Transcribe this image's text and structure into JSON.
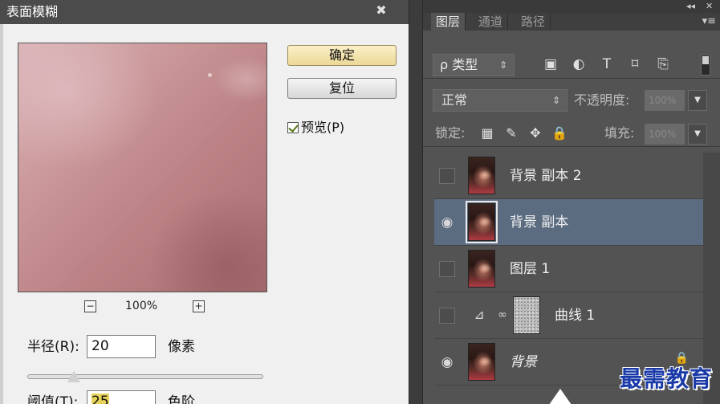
{
  "dialog": {
    "title": "表面模糊",
    "close_glyph": "✖",
    "zoom": {
      "out_glyph": "−",
      "level": "100%",
      "in_glyph": "+"
    },
    "buttons": {
      "ok": "确定",
      "reset": "复位"
    },
    "preview_checkbox": {
      "label": "预览(P)",
      "checked": true
    },
    "radius": {
      "label": "半径(R):",
      "value": "20",
      "unit": "像素",
      "slider_fraction": 0.18
    },
    "threshold": {
      "label": "阈值(T):",
      "value": "25",
      "unit": "色阶"
    }
  },
  "panel": {
    "top_controls": {
      "collapse": "◂◂",
      "close": "✕"
    },
    "tabs": [
      {
        "label": "图层",
        "active": true
      },
      {
        "label": "通道",
        "active": false
      },
      {
        "label": "路径",
        "active": false
      }
    ],
    "menu_glyph": "▾≡",
    "filter": {
      "kind_label": "ρ 类型",
      "kind_arrow": "⇕",
      "icons": [
        {
          "name": "pixel-filter-icon",
          "glyph": "▣"
        },
        {
          "name": "adjustment-filter-icon",
          "glyph": "◐"
        },
        {
          "name": "type-filter-icon",
          "glyph": "T"
        },
        {
          "name": "shape-filter-icon",
          "glyph": "⌑"
        },
        {
          "name": "smart-object-filter-icon",
          "glyph": "⎘"
        }
      ]
    },
    "blend": {
      "mode": "正常",
      "arrow": "⇕",
      "opacity_label": "不透明度:",
      "opacity_value": "100%"
    },
    "lock": {
      "label": "锁定:",
      "icons": [
        {
          "name": "lock-transparent-icon",
          "glyph": "▦"
        },
        {
          "name": "lock-paint-icon",
          "glyph": "✎"
        },
        {
          "name": "lock-position-icon",
          "glyph": "✥"
        },
        {
          "name": "lock-all-icon",
          "glyph": "🔒"
        }
      ],
      "fill_label": "填充:",
      "fill_value": "100%"
    },
    "layers": [
      {
        "name": "背景 副本 2",
        "visible": false,
        "selected": false,
        "type": "image"
      },
      {
        "name": "背景 副本",
        "visible": true,
        "selected": true,
        "type": "image"
      },
      {
        "name": "图层 1",
        "visible": false,
        "selected": false,
        "type": "image"
      },
      {
        "name": "曲线 1",
        "visible": false,
        "selected": false,
        "type": "curves"
      },
      {
        "name": "背景",
        "visible": true,
        "selected": false,
        "type": "background"
      }
    ],
    "eye_glyph": "◉",
    "curves_glyph": "⊿",
    "chain_glyph": "∞",
    "bg_lock_glyph": "🔒"
  },
  "watermark": "最需教育",
  "colors": {
    "dialog_bg": "#f0f0f0",
    "panel_bg": "#535353",
    "selected_layer": "#5b6b80",
    "ok_button": "#ecd996",
    "watermark": "#1a3aa8"
  }
}
